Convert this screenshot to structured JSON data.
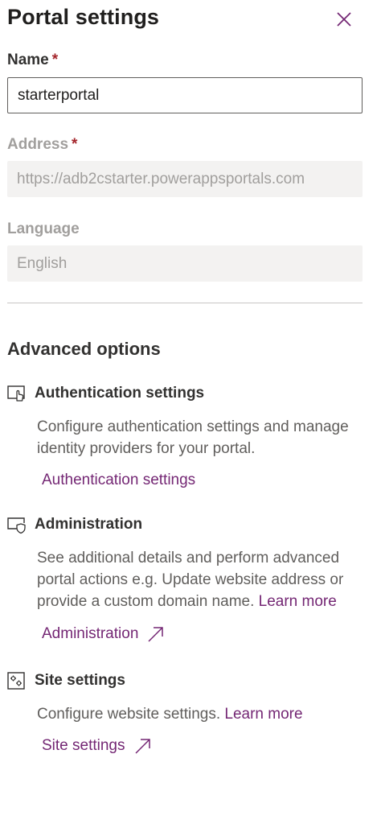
{
  "panel": {
    "title": "Portal settings",
    "close_icon": "close-icon"
  },
  "fields": {
    "name": {
      "label": "Name",
      "required_mark": "*",
      "value": "starterportal"
    },
    "address": {
      "label": "Address",
      "required_mark": "*",
      "value": "https://adb2cstarter.powerappsportals.com"
    },
    "language": {
      "label": "Language",
      "value": "English"
    }
  },
  "advanced": {
    "heading": "Advanced options",
    "authentication": {
      "icon": "authentication-icon",
      "title": "Authentication settings",
      "description": "Configure authentication settings and manage identity providers for your portal.",
      "link": "Authentication settings"
    },
    "administration": {
      "icon": "administration-icon",
      "title": "Administration",
      "description": "See additional details and perform advanced portal actions e.g. Update website address or provide a custom domain name.",
      "learn_more": "Learn more",
      "link": "Administration",
      "link_icon": "external-link-icon"
    },
    "site_settings": {
      "icon": "site-settings-icon",
      "title": "Site settings",
      "description": "Configure website settings.",
      "learn_more": "Learn more",
      "link": "Site settings",
      "link_icon": "external-link-icon"
    }
  },
  "colors": {
    "accent": "#742774",
    "required": "#a4262c",
    "readonly_bg": "#f3f2f1"
  }
}
